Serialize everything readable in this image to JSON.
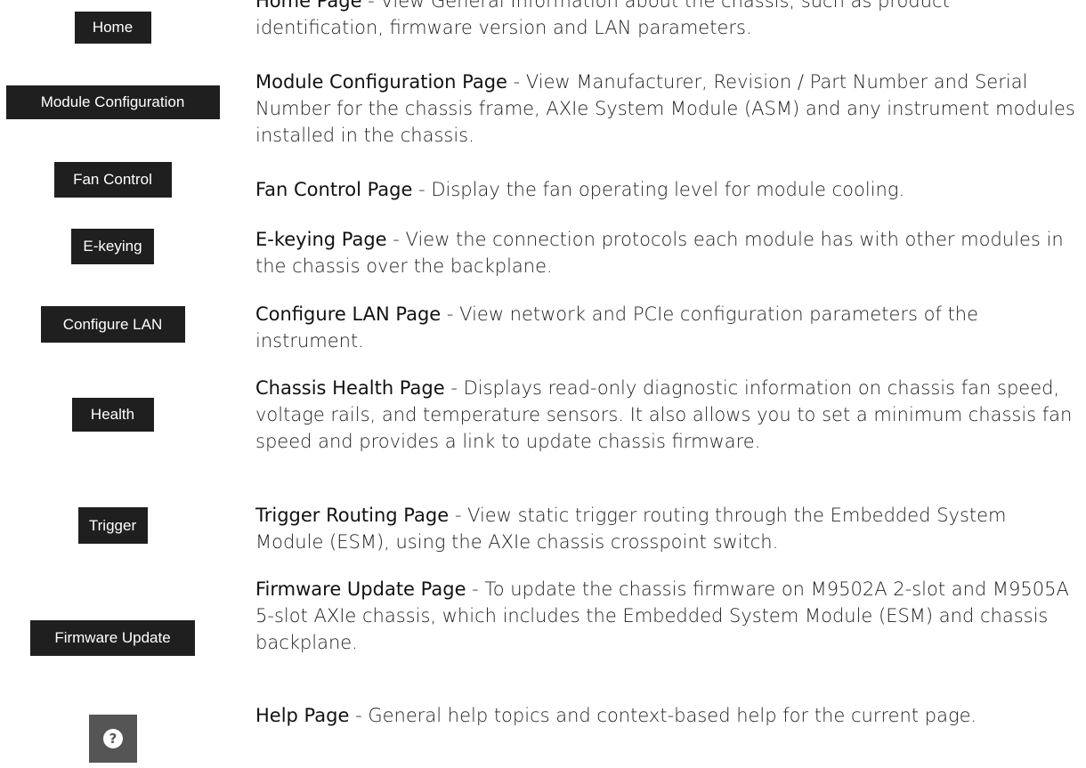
{
  "colors": {
    "button_bg": "#1f1f1f",
    "help_button_bg": "#555555",
    "button_text": "#ffffff",
    "body_text": "#222222"
  },
  "items": [
    {
      "button": "Home",
      "title": "Home Page",
      "desc": " - View General Information about the chassis, such as product identification, firmware version and LAN parameters."
    },
    {
      "button": "Module Configuration",
      "title": "Module Configuration Page",
      "desc": " - View Manufacturer, Revision / Part Number and Serial Number for the chassis frame, AXIe System Module (ASM) and any instrument modules installed in the chassis."
    },
    {
      "button": "Fan Control",
      "title": "Fan Control Page",
      "desc": " - Display the fan operating level for module cooling."
    },
    {
      "button": "E-keying",
      "title": "E-keying Page",
      "desc": " - View the connection protocols each module has with other modules in the chassis over the backplane."
    },
    {
      "button": "Configure LAN",
      "title": "Configure LAN Page",
      "desc": " - View network and PCIe configuration parameters of the instrument."
    },
    {
      "button": "Health",
      "title": "Chassis Health Page",
      "desc": " - Displays read-only diagnostic information on chassis fan speed, voltage rails, and temperature sensors. It also allows you to set a minimum chassis fan speed and provides a link to update chassis firmware."
    },
    {
      "button": "Trigger",
      "title": "Trigger Routing Page",
      "desc": " - View static trigger routing through the Embedded System Module (ESM), using the AXIe chassis crosspoint switch."
    },
    {
      "button": "Firmware Update",
      "title": "Firmware Update Page",
      "desc": " - To update the chassis firmware on M9502A 2-slot and M9505A 5-slot AXIe chassis, which includes the Embedded System Module (ESM) and chassis backplane."
    },
    {
      "button_icon": "question-circle-icon",
      "title": "Help Page",
      "desc": " - General help topics and context-based help for the current page."
    }
  ]
}
